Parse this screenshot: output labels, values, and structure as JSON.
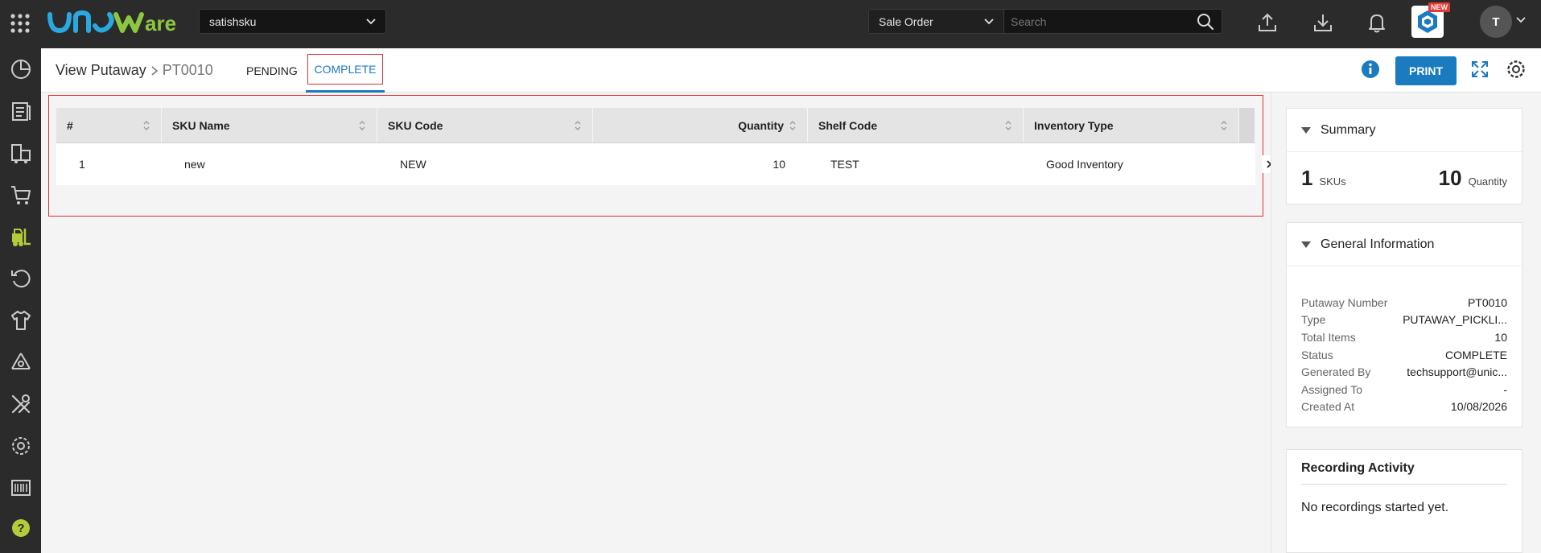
{
  "topbar": {
    "brand": "unware",
    "facility": "satishsku",
    "search_type": "Sale Order",
    "search_placeholder": "Search",
    "new_badge": "NEW",
    "avatar_initial": "T"
  },
  "sidebar": {
    "items": [
      {
        "icon": "dashboard-icon"
      },
      {
        "icon": "orders-icon"
      },
      {
        "icon": "shipping-icon"
      },
      {
        "icon": "cart-icon"
      },
      {
        "icon": "forklift-icon"
      },
      {
        "icon": "returns-icon"
      },
      {
        "icon": "shirt-icon"
      },
      {
        "icon": "recycle-icon"
      },
      {
        "icon": "tools-icon"
      },
      {
        "icon": "settings-icon"
      },
      {
        "icon": "barcode-icon"
      },
      {
        "icon": "help-icon"
      }
    ]
  },
  "header": {
    "crumb_root": "View Putaway",
    "crumb_id": "PT0010",
    "tabs": [
      "PENDING",
      "COMPLETE"
    ],
    "print_label": "PRINT"
  },
  "table": {
    "columns": [
      "#",
      "SKU Name",
      "SKU Code",
      "Quantity",
      "Shelf Code",
      "Inventory Type"
    ],
    "rows": [
      [
        "1",
        "new",
        "NEW",
        "10",
        "TEST",
        "Good Inventory"
      ]
    ]
  },
  "summary": {
    "title": "Summary",
    "skus_value": "1",
    "skus_label": "SKUs",
    "quantity_value": "10",
    "quantity_label": "Quantity"
  },
  "general": {
    "title": "General Information",
    "rows": [
      {
        "label": "Putaway Number",
        "value": "PT0010"
      },
      {
        "label": "Type",
        "value": "PUTAWAY_PICKLI..."
      },
      {
        "label": "Total Items",
        "value": "10"
      },
      {
        "label": "Status",
        "value": "COMPLETE"
      },
      {
        "label": "Generated By",
        "value": "techsupport@unic..."
      },
      {
        "label": "Assigned To",
        "value": "-"
      },
      {
        "label": "Created At",
        "value": "10/08/2026"
      }
    ]
  },
  "recording": {
    "title": "Recording Activity",
    "text": "No recordings started yet."
  },
  "colors": {
    "accent": "#1a7bc0",
    "topbar": "#2b2b2b",
    "highlight": "#e03030",
    "brand_green": "#8dc63f",
    "brand_blue": "#29a9e0"
  }
}
